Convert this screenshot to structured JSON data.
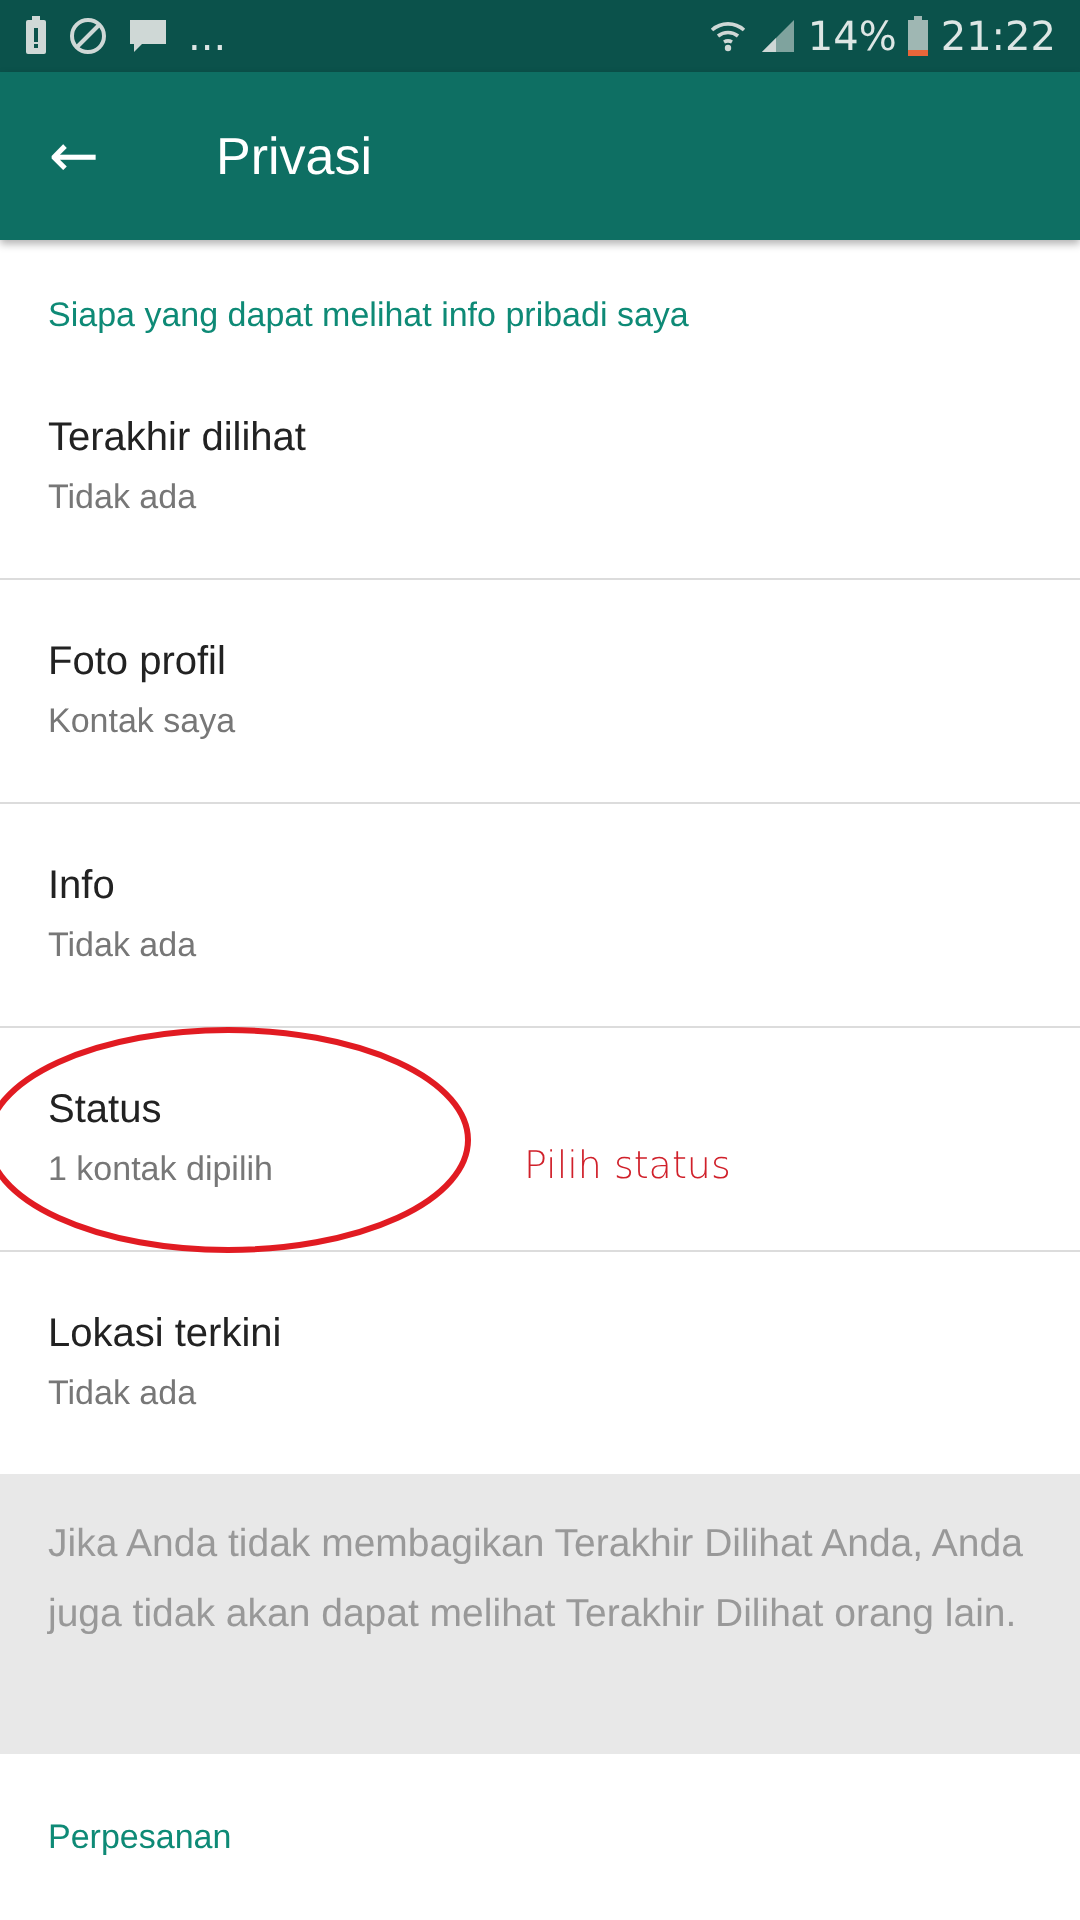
{
  "status_bar": {
    "battery_text": "14%",
    "time": "21:22",
    "overflow": "..."
  },
  "app_bar": {
    "back": "←",
    "title": "Privasi"
  },
  "section": "Siapa yang dapat melihat info pribadi saya",
  "items": [
    {
      "title": "Terakhir dilihat",
      "value": "Tidak ada",
      "circled": false
    },
    {
      "title": "Foto profil",
      "value": "Kontak saya",
      "circled": false
    },
    {
      "title": "Info",
      "value": "Tidak ada",
      "circled": false
    },
    {
      "title": "Status",
      "value": "1 kontak dipilih",
      "circled": true,
      "note": "Pilih status"
    },
    {
      "title": "Lokasi terkini",
      "value": "Tidak ada",
      "circled": false
    }
  ],
  "info_note": "Jika Anda tidak membagikan Terakhir Dilihat Anda, Anda juga tidak akan dapat melihat Terakhir Dilihat orang lain.",
  "section_2": "Perpesanan"
}
